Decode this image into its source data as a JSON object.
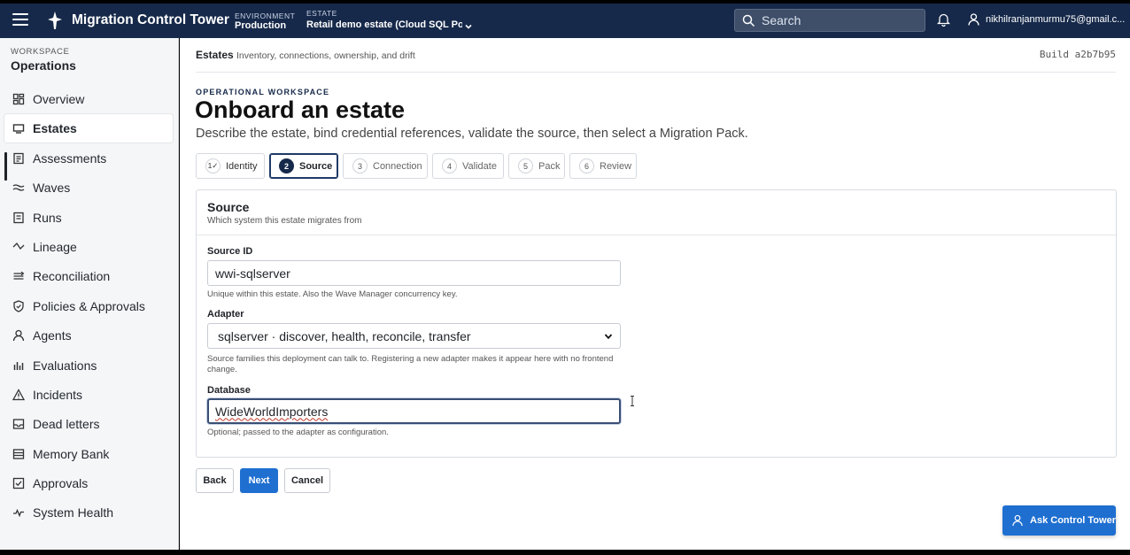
{
  "header": {
    "brand": "Migration Control Tower",
    "environment_label": "ENVIRONMENT",
    "environment_value": "Production",
    "estate_label": "ESTATE",
    "estate_value": "Retail demo estate (Cloud SQL Postgres)",
    "search_placeholder": "Search",
    "user_email": "nikhilranjanmurmu75@gmail.c..."
  },
  "sidebar": {
    "workspace_label": "WORKSPACE",
    "workspace_name": "Operations",
    "items": [
      {
        "label": "Overview",
        "icon": "dashboard-icon"
      },
      {
        "label": "Estates",
        "icon": "estate-icon"
      },
      {
        "label": "Assessments",
        "icon": "assessment-icon"
      },
      {
        "label": "Waves",
        "icon": "waves-icon"
      },
      {
        "label": "Runs",
        "icon": "runs-icon"
      },
      {
        "label": "Lineage",
        "icon": "lineage-icon"
      },
      {
        "label": "Reconciliation",
        "icon": "reconciliation-icon"
      },
      {
        "label": "Policies & Approvals",
        "icon": "shield-icon"
      },
      {
        "label": "Agents",
        "icon": "agent-icon"
      },
      {
        "label": "Evaluations",
        "icon": "bar-chart-icon"
      },
      {
        "label": "Incidents",
        "icon": "warning-icon"
      },
      {
        "label": "Dead letters",
        "icon": "inbox-icon"
      },
      {
        "label": "Memory Bank",
        "icon": "memory-icon"
      },
      {
        "label": "Approvals",
        "icon": "checkbox-icon"
      },
      {
        "label": "System Health",
        "icon": "pulse-icon"
      }
    ],
    "active_item": "Estates"
  },
  "breadcrumb": {
    "title": "Estates",
    "subtitle": "Inventory, connections, ownership, and drift",
    "build": "Build a2b7b95"
  },
  "page": {
    "eyebrow": "OPERATIONAL WORKSPACE",
    "title": "Onboard an estate",
    "description": "Describe the estate, bind credential references, validate the source, then select a Migration Pack."
  },
  "steps": [
    {
      "num": "1✓",
      "label": "Identity",
      "state": "done"
    },
    {
      "num": "2",
      "label": "Source",
      "state": "active"
    },
    {
      "num": "3",
      "label": "Connection",
      "state": "pending"
    },
    {
      "num": "4",
      "label": "Validate",
      "state": "pending"
    },
    {
      "num": "5",
      "label": "Pack",
      "state": "pending"
    },
    {
      "num": "6",
      "label": "Review",
      "state": "pending"
    }
  ],
  "form": {
    "title": "Source",
    "subtitle": "Which system this estate migrates from",
    "source_id_label": "Source ID",
    "source_id_value": "wwi-sqlserver",
    "source_id_help": "Unique within this estate. Also the Wave Manager concurrency key.",
    "adapter_label": "Adapter",
    "adapter_value": "sqlserver · discover, health, reconcile, transfer",
    "adapter_help": "Source families this deployment can talk to. Registering a new adapter makes it appear here with no frontend change.",
    "database_label": "Database",
    "database_value": "WideWorldImporters",
    "database_help": "Optional; passed to the adapter as configuration."
  },
  "actions": {
    "back": "Back",
    "next": "Next",
    "cancel": "Cancel"
  },
  "assistant": {
    "label": "Ask Control Tower"
  },
  "colors": {
    "topbar": "#16294a",
    "primary": "#1f6fd1",
    "sidebar_bg": "#f5f6f8"
  }
}
